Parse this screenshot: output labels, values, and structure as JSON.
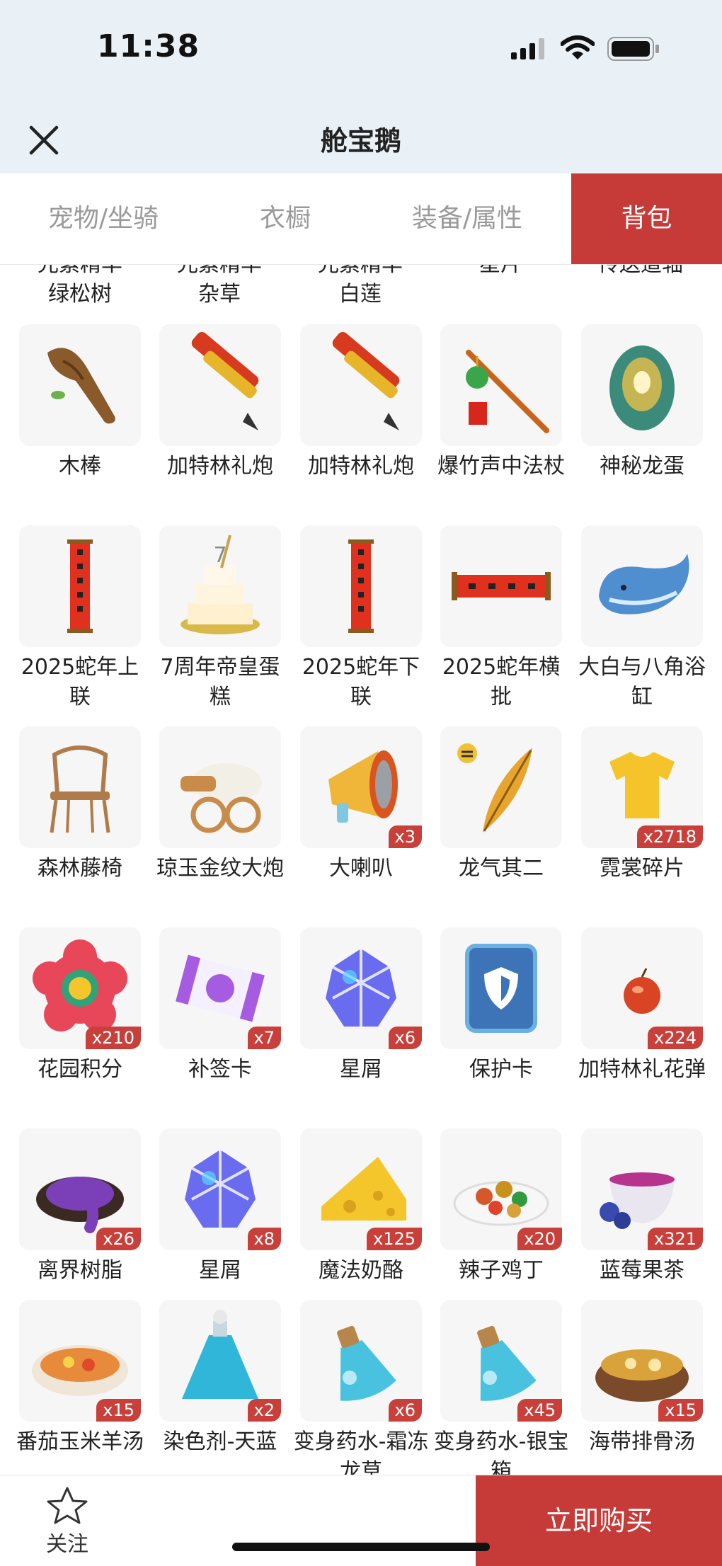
{
  "status": {
    "time": "11:38"
  },
  "nav": {
    "title": "舱宝鹅"
  },
  "tabs": [
    {
      "label": "宠物/坐骑",
      "active": false
    },
    {
      "label": "衣橱",
      "active": false
    },
    {
      "label": "装备/属性",
      "active": false
    },
    {
      "label": "背包",
      "active": true
    }
  ],
  "partial_top_labels": [
    [
      "光素精华",
      "绿松树"
    ],
    [
      "光素精华",
      "杂草"
    ],
    [
      "光素精华",
      "白莲"
    ],
    [
      "星片",
      ""
    ],
    [
      "传送道轴",
      ""
    ]
  ],
  "items": [
    {
      "name": "木棒",
      "count": "",
      "icon": "wooden-club-icon",
      "color": "#8a5a2b"
    },
    {
      "name": "加特林礼炮",
      "count": "",
      "icon": "gatling-salute-cannon-icon",
      "color": "#d63a1f"
    },
    {
      "name": "加特林礼炮",
      "count": "",
      "icon": "gatling-salute-cannon-icon",
      "color": "#d63a1f"
    },
    {
      "name": "爆竹声中法杖",
      "count": "",
      "icon": "firecracker-staff-icon",
      "color": "#c8651b"
    },
    {
      "name": "神秘龙蛋",
      "count": "",
      "icon": "mystery-dragon-egg-icon",
      "color": "#3b8a7a"
    },
    {
      "name": "2025蛇年上联",
      "count": "",
      "icon": "couplet-scroll-icon",
      "color": "#e0301e"
    },
    {
      "name": "7周年帝皇蛋糕",
      "count": "",
      "icon": "anniversary-cake-icon",
      "color": "#e9cf7a"
    },
    {
      "name": "2025蛇年下联",
      "count": "",
      "icon": "couplet-scroll-icon",
      "color": "#e0301e"
    },
    {
      "name": "2025蛇年横批",
      "count": "",
      "icon": "horizontal-scroll-icon",
      "color": "#e0301e"
    },
    {
      "name": "大白与八角浴缸",
      "count": "",
      "icon": "whale-bathtub-icon",
      "color": "#4f8fd0"
    },
    {
      "name": "森林藤椅",
      "count": "",
      "icon": "rattan-chair-icon",
      "color": "#b07b4a"
    },
    {
      "name": "琼玉金纹大炮",
      "count": "",
      "icon": "jade-cannon-icon",
      "color": "#c98b4a"
    },
    {
      "name": "大喇叭",
      "count": "x3",
      "icon": "megaphone-icon",
      "color": "#f0b63a"
    },
    {
      "name": "龙气其二",
      "count": "",
      "icon": "dragon-aura-feather-icon",
      "color": "#e7a52d"
    },
    {
      "name": "霓裳碎片",
      "count": "x2718",
      "icon": "tshirt-shard-icon",
      "color": "#f4c42a"
    },
    {
      "name": "花园积分",
      "count": "x210",
      "icon": "flower-badge-icon",
      "color": "#e8475a"
    },
    {
      "name": "补签卡",
      "count": "x7",
      "icon": "makeup-sign-card-icon",
      "color": "#a65ce0"
    },
    {
      "name": "星屑",
      "count": "x6",
      "icon": "stardust-icon",
      "color": "#6a6cf0"
    },
    {
      "name": "保护卡",
      "count": "",
      "icon": "shield-card-icon",
      "color": "#3d74b8"
    },
    {
      "name": "加特林礼花弹",
      "count": "x224",
      "icon": "firework-shell-icon",
      "color": "#d94424"
    },
    {
      "name": "离界树脂",
      "count": "x26",
      "icon": "resin-icon",
      "color": "#7b3fb8"
    },
    {
      "name": "星屑",
      "count": "x8",
      "icon": "stardust-icon",
      "color": "#6a6cf0"
    },
    {
      "name": "魔法奶酪",
      "count": "x125",
      "icon": "cheese-icon",
      "color": "#f5c62c"
    },
    {
      "name": "辣子鸡丁",
      "count": "x20",
      "icon": "spicy-chicken-icon",
      "color": "#d6582a"
    },
    {
      "name": "蓝莓果茶",
      "count": "x321",
      "icon": "blueberry-tea-icon",
      "color": "#b6338e"
    },
    {
      "name": "番茄玉米羊汤",
      "count": "x15",
      "icon": "tomato-corn-soup-icon",
      "color": "#e78a3c"
    },
    {
      "name": "染色剂-天蓝",
      "count": "x2",
      "icon": "sky-blue-dye-icon",
      "color": "#2fb6d8"
    },
    {
      "name": "变身药水-霜冻龙草",
      "count": "x6",
      "icon": "transform-potion-icon",
      "color": "#49c2e0"
    },
    {
      "name": "变身药水-银宝箱",
      "count": "x45",
      "icon": "transform-potion-icon",
      "color": "#49c2e0"
    },
    {
      "name": "海带排骨汤",
      "count": "x15",
      "icon": "kelp-rib-soup-icon",
      "color": "#d9a23a"
    }
  ],
  "bottom": {
    "follow_label": "关注",
    "buy_label": "立即购买"
  }
}
